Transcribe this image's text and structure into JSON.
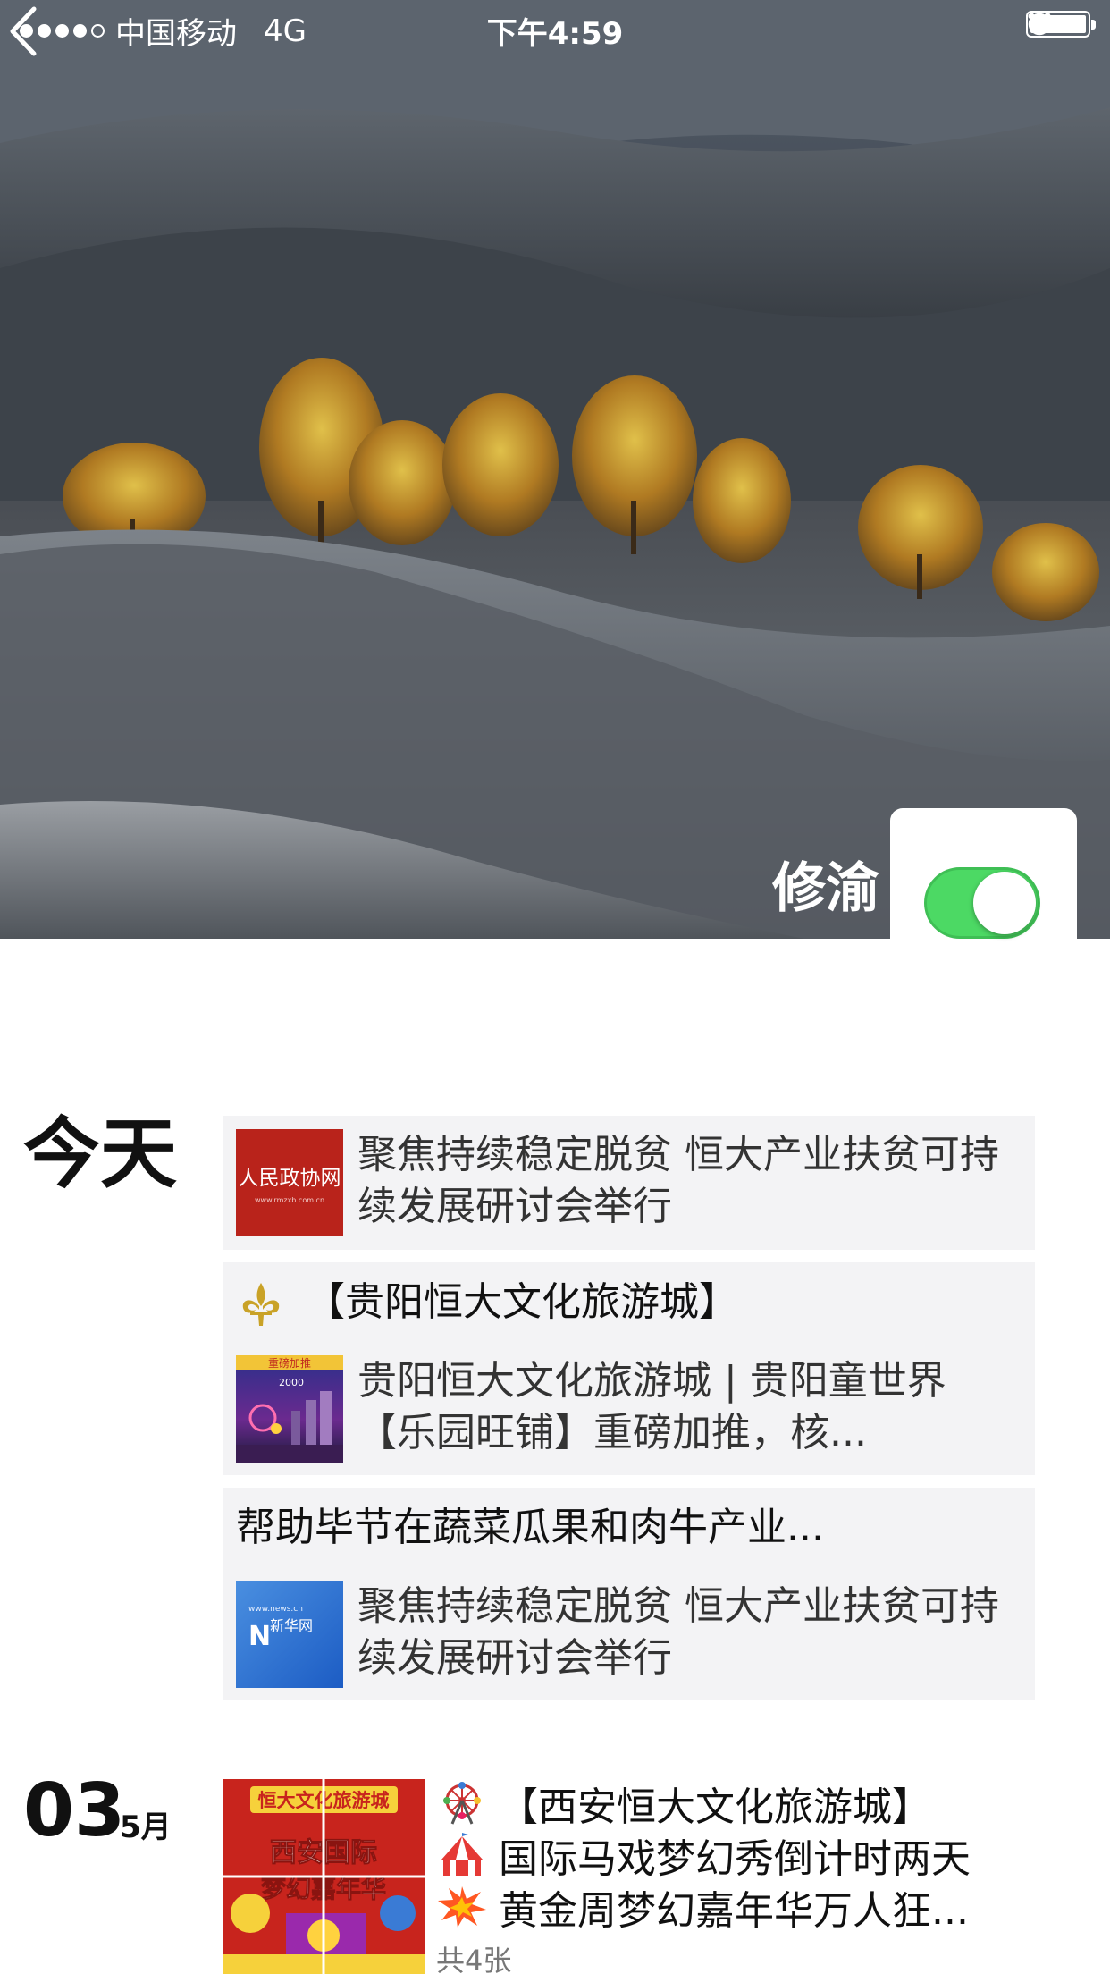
{
  "status_bar": {
    "carrier": "中国移动",
    "network": "4G",
    "time": "下午4:59"
  },
  "profile": {
    "username": "修渝"
  },
  "feed": {
    "today_label": "今天",
    "today_items": [
      {
        "source_logo": "人民政协网",
        "source_url": "www.rmzxb.com.cn",
        "text": "聚焦持续稳定脱贫 恒大产业扶贫可持续发展研讨会举行"
      },
      {
        "title": "【贵阳恒大文化旅游城】",
        "title_icon": "fleur-de-lis-icon",
        "thumb_label": "重磅加推",
        "thumb_price": "2000",
        "text": "贵阳恒大文化旅游城 | 贵阳童世界【乐园旺铺】重磅加推，核..."
      },
      {
        "title": "帮助毕节在蔬菜瓜果和肉牛产业...",
        "source_logo": "新华网",
        "source_url": "www.news.cn",
        "text": "聚焦持续稳定脱贫 恒大产业扶贫可持续发展研讨会举行"
      }
    ],
    "dated_post": {
      "day": "03",
      "month": "5月",
      "lines": [
        {
          "icon": "ferris-wheel-icon",
          "text": "【西安恒大文化旅游城】"
        },
        {
          "icon": "circus-tent-icon",
          "text": "国际马戏梦幻秀倒计时两天"
        },
        {
          "icon": "collision-icon",
          "text": "黄金周梦幻嘉年华万人狂..."
        }
      ],
      "photo_title": "恒大文化旅游城",
      "photo_subtitle": "西安国际",
      "photo_subtitle2": "梦幻嘉年华",
      "photo_count": "共4张"
    }
  }
}
